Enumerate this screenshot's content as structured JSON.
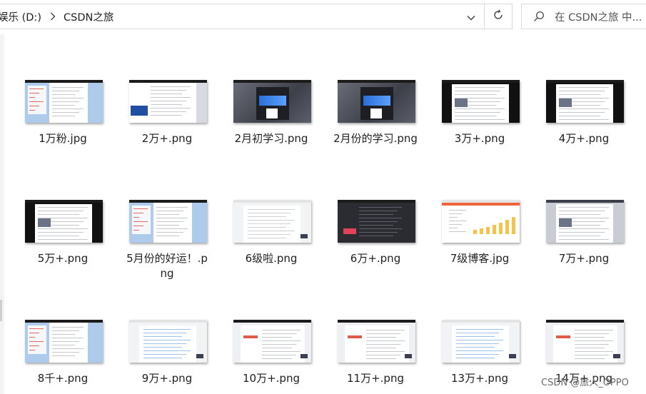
{
  "address": {
    "crumbs": [
      "娱乐 (D:)",
      "CSDN之旅"
    ]
  },
  "search": {
    "placeholder": "在 CSDN之旅 中..."
  },
  "files": [
    {
      "name": "1万粉.jpg",
      "style": "blue"
    },
    {
      "name": "2万+.png",
      "style": "dark-left"
    },
    {
      "name": "2月初学习.png",
      "style": "dark-city"
    },
    {
      "name": "2月份的学习.png",
      "style": "dark-city"
    },
    {
      "name": "3万+.png",
      "style": "dark-frame"
    },
    {
      "name": "4万+.png",
      "style": "dark-frame"
    },
    {
      "name": "5万+.png",
      "style": "dark-frame"
    },
    {
      "name": "5月份的好运！.png",
      "style": "blue"
    },
    {
      "name": "6级啦.png",
      "style": "light"
    },
    {
      "name": "6万+.png",
      "style": "dark-full"
    },
    {
      "name": "7级博客.jpg",
      "style": "chart"
    },
    {
      "name": "7万+.png",
      "style": "grey-frame"
    },
    {
      "name": "8千+.png",
      "style": "blue"
    },
    {
      "name": "9万+.png",
      "style": "list-light"
    },
    {
      "name": "10万+.png",
      "style": "light-red"
    },
    {
      "name": "11万+.png",
      "style": "light-red"
    },
    {
      "name": "13万+.png",
      "style": "list-light"
    },
    {
      "name": "14万+.png",
      "style": "light-red"
    }
  ],
  "watermark": "CSDN @旅人_OPPO"
}
